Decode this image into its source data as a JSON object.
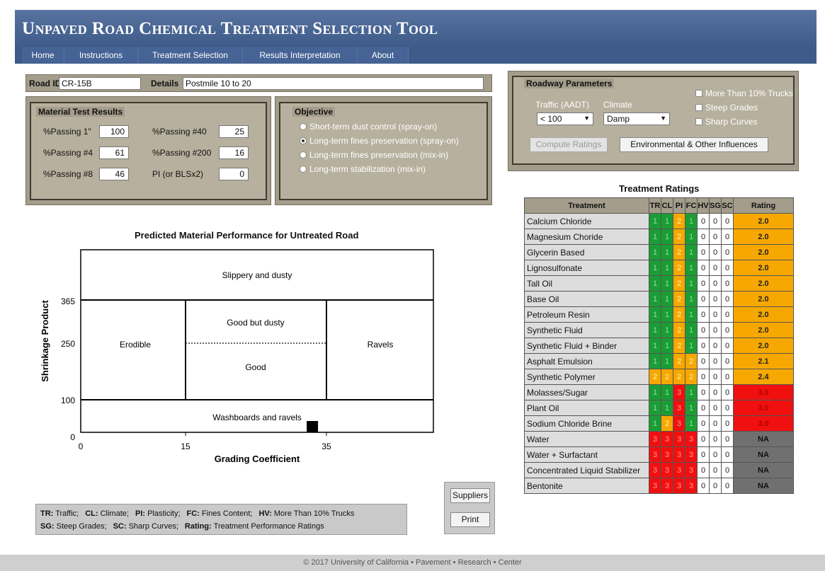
{
  "app": {
    "title": "Unpaved Road Chemical Treatment Selection Tool"
  },
  "nav": [
    "Home",
    "Instructions",
    "Treatment Selection",
    "Results Interpretation",
    "About"
  ],
  "road": {
    "id_label": "Road ID",
    "id_value": "CR-15B",
    "details_label": "Details",
    "details_value": "Postmile 10 to 20"
  },
  "material": {
    "legend": "Material Test Results",
    "fields": [
      {
        "label": "%Passing 1\"",
        "value": "100"
      },
      {
        "label": "%Passing #40",
        "value": "25"
      },
      {
        "label": "%Passing #4",
        "value": "61"
      },
      {
        "label": "%Passing #200",
        "value": "16"
      },
      {
        "label": "%Passing #8",
        "value": "46"
      },
      {
        "label": "PI (or BLSx2)",
        "value": "0"
      }
    ]
  },
  "objective": {
    "legend": "Objective",
    "options": [
      {
        "label": "Short-term dust control (spray-on)",
        "selected": false
      },
      {
        "label": "Long-term fines preservation (spray-on)",
        "selected": true
      },
      {
        "label": "Long-term fines preservation (mix-in)",
        "selected": false
      },
      {
        "label": "Long-term stabilization (mix-in)",
        "selected": false
      }
    ]
  },
  "params": {
    "legend": "Roadway Parameters",
    "traffic_label": "Traffic (AADT)",
    "traffic_value": "< 100",
    "climate_label": "Climate",
    "climate_value": "Damp",
    "checks": [
      "More Than 10% Trucks",
      "Steep Grades",
      "Sharp Curves"
    ],
    "compute_label": "Compute Ratings",
    "env_label": "Environmental & Other Influences"
  },
  "chart": {
    "title": "Predicted Material Performance for Untreated Road",
    "xlabel": "Grading Coefficient",
    "ylabel": "Shrinkage Product",
    "xticks": [
      "0",
      "15",
      "35"
    ],
    "yticks": [
      "365",
      "250",
      "100",
      "0"
    ],
    "regions": [
      "Slippery and dusty",
      "Good but dusty",
      "Good",
      "Erodible",
      "Ravels",
      "Washboards and ravels"
    ],
    "marker": {
      "grading_coefficient": 33,
      "shrinkage_product": 0
    }
  },
  "ratings": {
    "title": "Treatment Ratings",
    "headers": [
      "Treatment",
      "TR",
      "CL",
      "PI",
      "FC",
      "HV",
      "SG",
      "SC",
      "Rating"
    ],
    "rows": [
      {
        "name": "Calcium Chloride",
        "v": [
          "1",
          "1",
          "2",
          "1",
          "0",
          "0",
          "0"
        ],
        "r": "2.0"
      },
      {
        "name": "Magnesium Choride",
        "v": [
          "1",
          "1",
          "2",
          "1",
          "0",
          "0",
          "0"
        ],
        "r": "2.0"
      },
      {
        "name": "Glycerin Based",
        "v": [
          "1",
          "1",
          "2",
          "1",
          "0",
          "0",
          "0"
        ],
        "r": "2.0"
      },
      {
        "name": "Lignosulfonate",
        "v": [
          "1",
          "1",
          "2",
          "1",
          "0",
          "0",
          "0"
        ],
        "r": "2.0"
      },
      {
        "name": "Tall Oil",
        "v": [
          "1",
          "1",
          "2",
          "1",
          "0",
          "0",
          "0"
        ],
        "r": "2.0"
      },
      {
        "name": "Base Oil",
        "v": [
          "1",
          "1",
          "2",
          "1",
          "0",
          "0",
          "0"
        ],
        "r": "2.0"
      },
      {
        "name": "Petroleum Resin",
        "v": [
          "1",
          "1",
          "2",
          "1",
          "0",
          "0",
          "0"
        ],
        "r": "2.0"
      },
      {
        "name": "Synthetic Fluid",
        "v": [
          "1",
          "1",
          "2",
          "1",
          "0",
          "0",
          "0"
        ],
        "r": "2.0"
      },
      {
        "name": "Synthetic Fluid + Binder",
        "v": [
          "1",
          "1",
          "2",
          "1",
          "0",
          "0",
          "0"
        ],
        "r": "2.0"
      },
      {
        "name": "Asphalt Emulsion",
        "v": [
          "1",
          "1",
          "2",
          "2",
          "0",
          "0",
          "0"
        ],
        "r": "2.1"
      },
      {
        "name": "Synthetic Polymer",
        "v": [
          "2",
          "2",
          "2",
          "2",
          "0",
          "0",
          "0"
        ],
        "r": "2.4"
      },
      {
        "name": "Molasses/Sugar",
        "v": [
          "1",
          "1",
          "3",
          "1",
          "0",
          "0",
          "0"
        ],
        "r": "3.0"
      },
      {
        "name": "Plant Oil",
        "v": [
          "1",
          "1",
          "3",
          "1",
          "0",
          "0",
          "0"
        ],
        "r": "3.0"
      },
      {
        "name": "Sodium Chloride Brine",
        "v": [
          "1",
          "2",
          "3",
          "1",
          "0",
          "0",
          "0"
        ],
        "r": "3.0"
      },
      {
        "name": "Water",
        "v": [
          "3",
          "3",
          "3",
          "3",
          "0",
          "0",
          "0"
        ],
        "r": "NA"
      },
      {
        "name": "Water + Surfactant",
        "v": [
          "3",
          "3",
          "3",
          "3",
          "0",
          "0",
          "0"
        ],
        "r": "NA"
      },
      {
        "name": "Concentrated Liquid Stabilizer",
        "v": [
          "3",
          "3",
          "3",
          "3",
          "0",
          "0",
          "0"
        ],
        "r": "NA"
      },
      {
        "name": "Bentonite",
        "v": [
          "3",
          "3",
          "3",
          "3",
          "0",
          "0",
          "0"
        ],
        "r": "NA"
      }
    ]
  },
  "abbrev": {
    "line1": [
      [
        "TR:",
        "Traffic;"
      ],
      [
        "CL:",
        "Climate;"
      ],
      [
        "PI:",
        "Plasticity;"
      ],
      [
        "FC:",
        "Fines Content;"
      ],
      [
        "HV:",
        "More Than 10% Trucks"
      ]
    ],
    "line2": [
      [
        "SG:",
        "Steep Grades;"
      ],
      [
        "SC:",
        "Sharp Curves;"
      ],
      [
        "Rating:",
        "Treatment Performance Ratings"
      ]
    ]
  },
  "buttons": {
    "suppliers": "Suppliers",
    "print": "Print"
  },
  "footer": {
    "copyright": "© 2017 University of California",
    "sep": "•",
    "words": [
      "Pavement",
      "Research",
      "Center"
    ]
  },
  "colors": {
    "good": "#1b9d36",
    "fair": "#f6a800",
    "poor": "#f01010",
    "na": "#707070",
    "header": "#3e5b89",
    "panel": "#a49d8b"
  }
}
